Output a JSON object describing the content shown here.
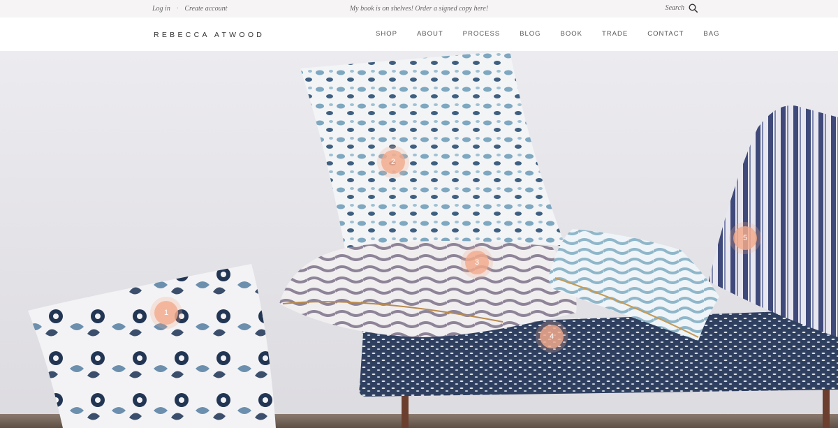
{
  "topbar": {
    "login": "Log in",
    "separator": "·",
    "create_account": "Create account",
    "promo": "My book is on shelves! Order a signed copy here!",
    "search_label": "Search",
    "search_icon": "search-icon"
  },
  "header": {
    "logo": "REBECCA ATWOOD",
    "nav": [
      "SHOP",
      "ABOUT",
      "PROCESS",
      "BLOG",
      "BOOK",
      "TRADE",
      "CONTACT",
      "BAG"
    ]
  },
  "hero": {
    "hotspots": [
      "1",
      "2",
      "3",
      "4",
      "5"
    ],
    "colors": {
      "wall": "#e9e8ec",
      "accent": "#f2aa8c",
      "indigo": "#3f4a7a",
      "pillow_blue": "#7ea7c0"
    }
  }
}
